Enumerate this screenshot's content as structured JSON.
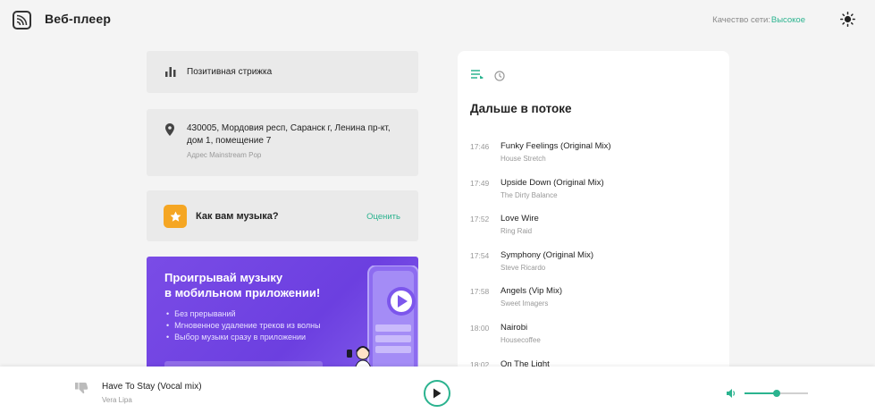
{
  "header": {
    "title": "Веб-плеер",
    "network_label": "Качество сети:",
    "network_value": "Высокое"
  },
  "station": {
    "name": "Позитивная стрижка"
  },
  "address": {
    "line1": "430005, Мордовия респ, Саранск г, Ленина пр-кт,",
    "line2": "дом 1, помещение 7",
    "sub": "Адрес Mainstream Pop"
  },
  "rating": {
    "question": "Как вам музыка?",
    "action": "Оценить"
  },
  "promo": {
    "title_line1": "Проигрывай музыку",
    "title_line2": "в мобильном приложении!",
    "bullets": [
      "Без прерываний",
      "Мгновенное удаление треков из волны",
      "Выбор музыки сразу в приложении"
    ]
  },
  "queue": {
    "title": "Дальше в потоке",
    "items": [
      {
        "time": "17:46",
        "title": "Funky Feelings (Original Mix)",
        "artist": "House Stretch"
      },
      {
        "time": "17:49",
        "title": "Upside Down (Original Mix)",
        "artist": "The Dirty Balance"
      },
      {
        "time": "17:52",
        "title": "Love Wire",
        "artist": "Ring Raid"
      },
      {
        "time": "17:54",
        "title": "Symphony (Original Mix)",
        "artist": "Steve Ricardo"
      },
      {
        "time": "17:58",
        "title": "Angels (Vip Mix)",
        "artist": "Sweet Imagers"
      },
      {
        "time": "18:00",
        "title": "Nairobi",
        "artist": "Housecoffee"
      },
      {
        "time": "18:02",
        "title": "On The Light",
        "artist": ""
      }
    ]
  },
  "player": {
    "track_title": "Have To Stay (Vocal mix)",
    "track_artist": "Vera Lipa",
    "volume": 0.5
  },
  "colors": {
    "accent": "#2bb38f",
    "promo": "#6c3fe0",
    "star": "#f5a623"
  }
}
